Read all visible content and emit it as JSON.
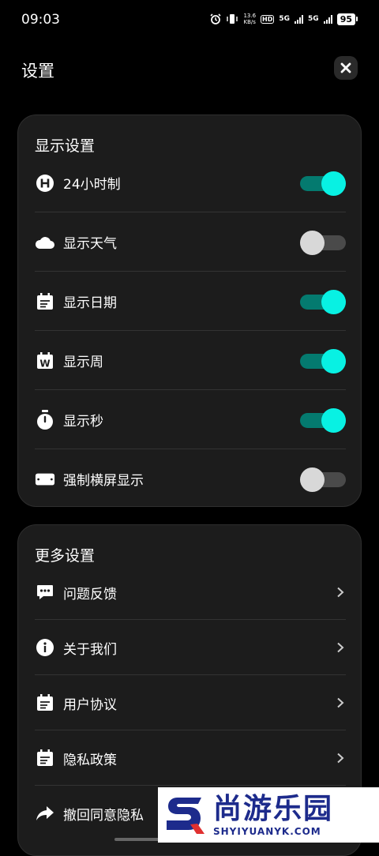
{
  "status_bar": {
    "time": "09:03",
    "speed_value": "13.6",
    "speed_unit": "KB/s",
    "hd_label": "HD",
    "sim1_label": "5G",
    "sim2_label": "5G",
    "battery": "95"
  },
  "header": {
    "title": "设置",
    "close_icon": "close-icon"
  },
  "display_settings": {
    "title": "显示设置",
    "items": [
      {
        "label": "24小时制",
        "icon": "h-circle-icon",
        "enabled": true
      },
      {
        "label": "显示天气",
        "icon": "cloud-icon",
        "enabled": false
      },
      {
        "label": "显示日期",
        "icon": "calendar-icon",
        "enabled": true
      },
      {
        "label": "显示周",
        "icon": "calendar-week-icon",
        "icon_letter": "W",
        "enabled": true
      },
      {
        "label": "显示秒",
        "icon": "stopwatch-icon",
        "enabled": true
      },
      {
        "label": "强制横屏显示",
        "icon": "landscape-icon",
        "enabled": false
      }
    ]
  },
  "more_settings": {
    "title": "更多设置",
    "items": [
      {
        "label": "问题反馈",
        "icon": "chat-icon"
      },
      {
        "label": "关于我们",
        "icon": "info-icon"
      },
      {
        "label": "用户协议",
        "icon": "document-icon"
      },
      {
        "label": "隐私政策",
        "icon": "document-icon"
      },
      {
        "label": "撤回同意隐私",
        "icon": "share-arrow-icon"
      }
    ]
  },
  "watermark": {
    "chinese": "尚游乐园",
    "domain": "SHYIYUANYK.COM"
  },
  "colors": {
    "toggle_on_knob": "#08f1e3",
    "toggle_on_track": "#047a6f",
    "toggle_off_knob": "#d8d8d8",
    "toggle_off_track": "#4a4a4a",
    "card_bg": "#1c1c1c",
    "watermark_blue": "#1d2b8c"
  }
}
